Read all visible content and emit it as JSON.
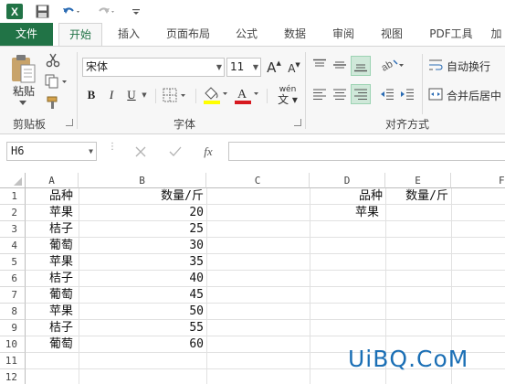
{
  "quick_access": {
    "app_icon": "excel-logo-icon",
    "save_icon": "save-icon",
    "undo_icon": "undo-icon",
    "redo_icon": "redo-icon",
    "customize_icon": "customize-qat-icon"
  },
  "tabs": [
    "文件",
    "开始",
    "插入",
    "页面布局",
    "公式",
    "数据",
    "审阅",
    "视图",
    "PDF工具",
    "加"
  ],
  "active_tab_index": 1,
  "ribbon": {
    "clipboard": {
      "paste_label": "粘贴",
      "group_label": "剪贴板"
    },
    "font": {
      "font_name": "宋体",
      "font_size": "11",
      "bold": "B",
      "italic": "I",
      "underline": "U",
      "grow_font": "A",
      "shrink_font": "A",
      "font_color": "A",
      "phonetic": "wén",
      "group_label": "字体"
    },
    "alignment": {
      "wrap_text_label": "自动换行",
      "merge_center_label": "合并后居中",
      "group_label": "对齐方式"
    }
  },
  "formula_bar": {
    "name_box": "H6",
    "cancel_icon": "cancel-x-icon",
    "enter_icon": "enter-check-icon",
    "fx_label": "fx",
    "formula_value": ""
  },
  "sheet": {
    "columns": [
      "A",
      "B",
      "C",
      "D",
      "E",
      "F"
    ],
    "rows": [
      "1",
      "2",
      "3",
      "4",
      "5",
      "6",
      "7",
      "8",
      "9",
      "10",
      "11",
      "12"
    ],
    "col_a": [
      "品种",
      "苹果",
      "桔子",
      "葡萄",
      "苹果",
      "桔子",
      "葡萄",
      "苹果",
      "桔子",
      "葡萄"
    ],
    "col_b": [
      "数量/斤",
      "20",
      "25",
      "30",
      "35",
      "40",
      "45",
      "50",
      "55",
      "60"
    ],
    "d1": "品种",
    "e1": "数量/斤",
    "d2": "苹果"
  },
  "watermark": "UiBQ.CoM",
  "colors": {
    "excel_green": "#217346",
    "highlight": "#cfe8d9",
    "font_color_bar": "#d71920",
    "fill_color_bar": "#ffff00"
  }
}
